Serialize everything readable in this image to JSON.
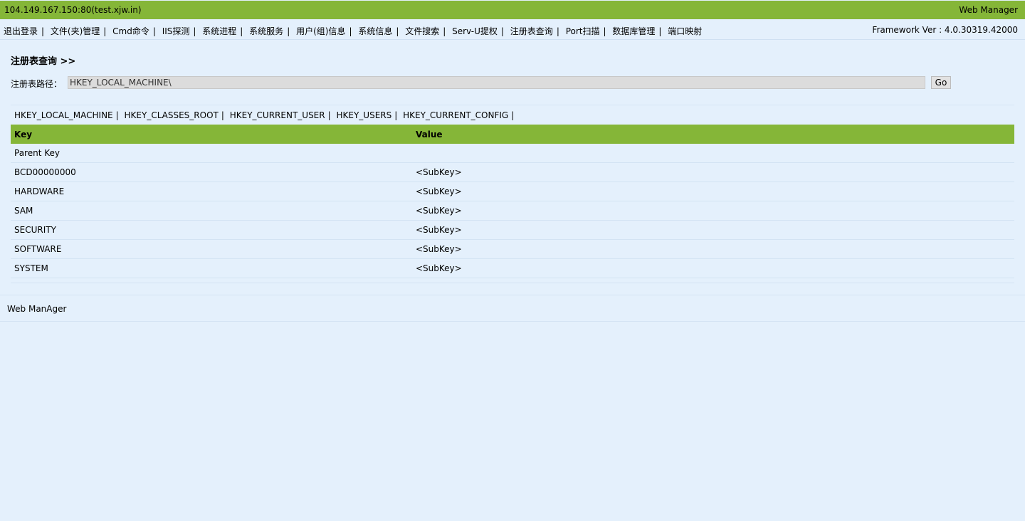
{
  "header": {
    "host": "104.149.167.150:80(test.xjw.in)",
    "brand": "Web Manager"
  },
  "menu": {
    "items": [
      "退出登录",
      "文件(夹)管理",
      "Cmd命令",
      "IIS探测",
      "系统进程",
      "系统服务",
      "用户(组)信息",
      "系统信息",
      "文件搜索",
      "Serv-U提权",
      "注册表查询",
      "Port扫描",
      "数据库管理",
      "端口映射"
    ],
    "separator": "|",
    "framework": "Framework Ver : 4.0.30319.42000"
  },
  "registry": {
    "title": "注册表查询 >>",
    "path_label": "注册表路径：",
    "path_value": "HKEY_LOCAL_MACHINE\\",
    "go_label": "Go",
    "hives": [
      "HKEY_LOCAL_MACHINE",
      "HKEY_CLASSES_ROOT",
      "HKEY_CURRENT_USER",
      "HKEY_USERS",
      "HKEY_CURRENT_CONFIG"
    ],
    "table": {
      "headers": [
        "Key",
        "Value"
      ],
      "parent_key": "Parent Key",
      "rows": [
        {
          "key": "BCD00000000",
          "value": "<SubKey>"
        },
        {
          "key": "HARDWARE",
          "value": "<SubKey>"
        },
        {
          "key": "SAM",
          "value": "<SubKey>"
        },
        {
          "key": "SECURITY",
          "value": "<SubKey>"
        },
        {
          "key": "SOFTWARE",
          "value": "<SubKey>"
        },
        {
          "key": "SYSTEM",
          "value": "<SubKey>"
        }
      ]
    }
  },
  "footer": {
    "text": "Web ManAger"
  },
  "colors": {
    "accent": "#85b638",
    "background": "#e4f0fc"
  }
}
